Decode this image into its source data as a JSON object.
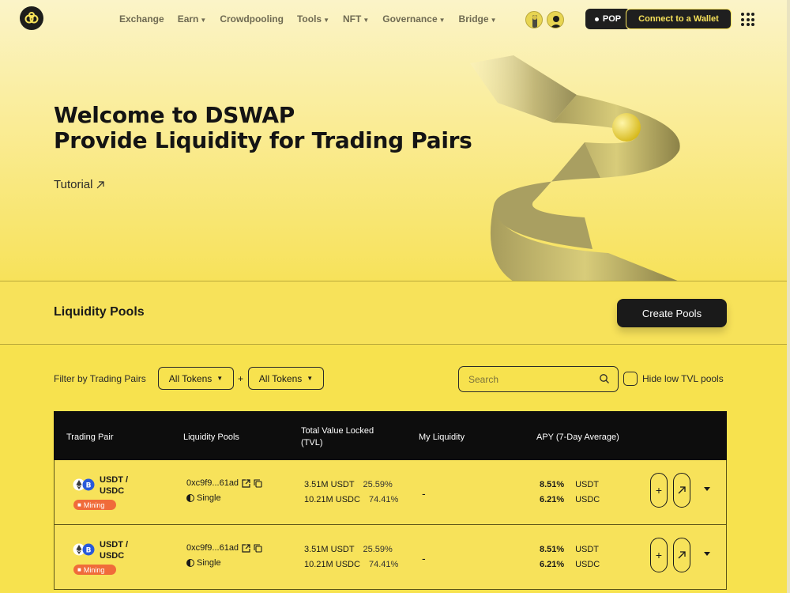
{
  "nav": {
    "items": [
      {
        "label": "Exchange",
        "dropdown": false
      },
      {
        "label": "Earn",
        "dropdown": true
      },
      {
        "label": "Crowdpooling",
        "dropdown": false
      },
      {
        "label": "Tools",
        "dropdown": true
      },
      {
        "label": "NFT",
        "dropdown": true
      },
      {
        "label": "Governance",
        "dropdown": true
      },
      {
        "label": "Bridge",
        "dropdown": true
      }
    ],
    "pop_label": "POP",
    "connect_label": "Connect to a Wallet"
  },
  "hero": {
    "title_line1": "Welcome to DSWAP",
    "title_line2": "Provide Liquidity for Trading Pairs",
    "tutorial_label": "Tutorial"
  },
  "section": {
    "title": "Liquidity Pools",
    "create_label": "Create Pools"
  },
  "filter": {
    "label": "Filter by Trading Pairs",
    "token_a": "All Tokens",
    "token_b": "All Tokens",
    "plus": "+",
    "search_placeholder": "Search",
    "hide_label": "Hide low TVL pools"
  },
  "table": {
    "headers": {
      "pair": "Trading Pair",
      "pools": "Liquidity Pools",
      "tvl_line1": "Total Value Locked",
      "tvl_line2": "(TVL)",
      "my": "My Liquidity",
      "apy": "APY (7-Day Average)"
    },
    "rows": [
      {
        "pair_line1": "USDT /",
        "pair_line2": "USDC",
        "badge": "Mining",
        "address": "0xc9f9...61ad",
        "type": "Single",
        "tvl": [
          {
            "amount": "3.51M",
            "token": "USDT",
            "pct": "25.59%"
          },
          {
            "amount": "10.21M",
            "token": "USDC",
            "pct": "74.41%"
          }
        ],
        "my_liquidity": "-",
        "apy": [
          {
            "value": "8.51%",
            "token": "USDT"
          },
          {
            "value": "6.21%",
            "token": "USDC"
          }
        ]
      },
      {
        "pair_line1": "USDT /",
        "pair_line2": "USDC",
        "badge": "Mining",
        "address": "0xc9f9...61ad",
        "type": "Single",
        "tvl": [
          {
            "amount": "3.51M",
            "token": "USDT",
            "pct": "25.59%"
          },
          {
            "amount": "10.21M",
            "token": "USDC",
            "pct": "74.41%"
          }
        ],
        "my_liquidity": "-",
        "apy": [
          {
            "value": "8.51%",
            "token": "USDT"
          },
          {
            "value": "6.21%",
            "token": "USDC"
          }
        ]
      }
    ]
  },
  "colors": {
    "accent": "#f7e25a",
    "dark": "#1a1a1a",
    "badge": "#f06b3a"
  }
}
